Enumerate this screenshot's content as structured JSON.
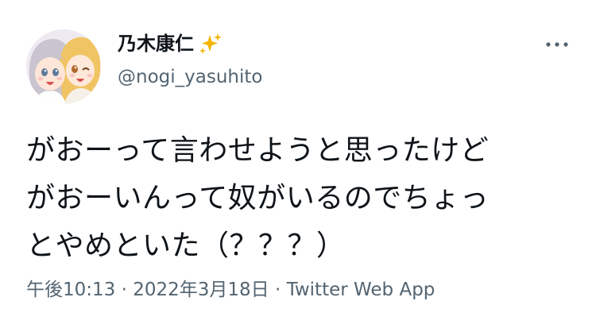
{
  "author": {
    "display_name": "乃木康仁",
    "name_emoji_icon": "sparkles-icon",
    "handle": "@nogi_yasuhito",
    "avatar_icon": "anime-girls-avatar"
  },
  "menu": {
    "icon": "more-horizontal-icon"
  },
  "tweet": {
    "text": "がおーって言わせようと思ったけど\nがおーいんって奴がいるのでちょっ\nとやめといた（？？？）"
  },
  "meta": {
    "time": "午後10:13",
    "separator_1": " · ",
    "date": "2022年3月18日",
    "separator_2": " · ",
    "source": "Twitter Web App"
  },
  "colors": {
    "text_primary": "#0f1419",
    "text_secondary": "#536471",
    "sparkle": "#f5b400",
    "background": "#ffffff"
  }
}
